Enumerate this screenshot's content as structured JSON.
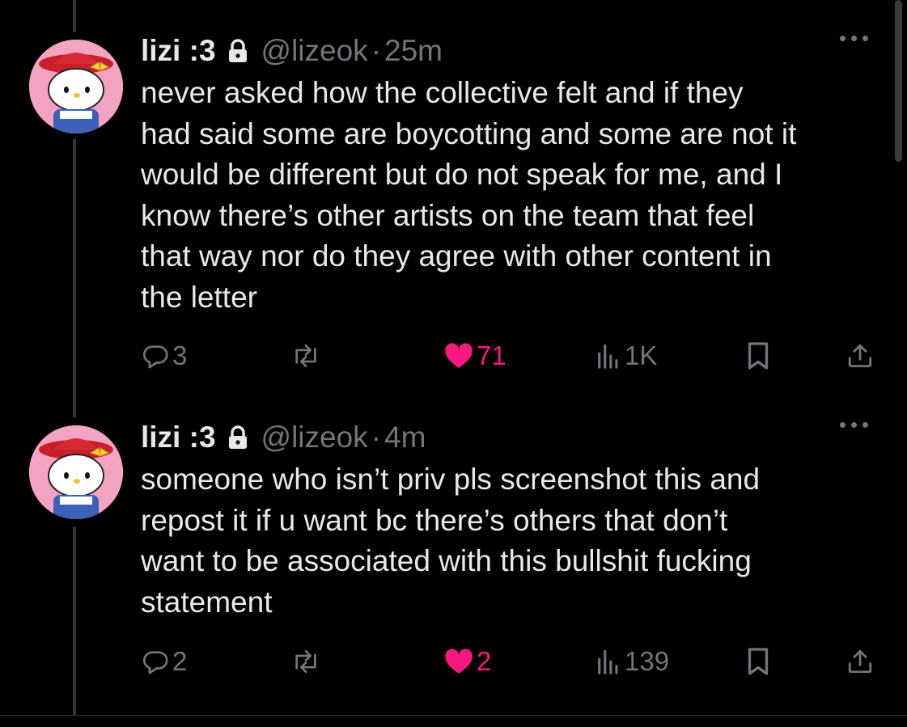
{
  "tweets": [
    {
      "display_name": "lizi :3",
      "handle": "@lizeok",
      "separator": "·",
      "time": "25m",
      "text": "never asked how the collective felt and if they\nhad said some are boycotting and some are not it\nwould be different but do not speak for me, and I\nknow there’s other artists on the team that feel\nthat way nor do they agree with other content in\nthe letter",
      "replies": "3",
      "likes": "71",
      "views": "1K",
      "liked": true
    },
    {
      "display_name": "lizi :3",
      "handle": "@lizeok",
      "separator": "·",
      "time": "4m",
      "text": "someone who isn’t priv pls screenshot this and\nrepost it if u want bc there’s others that don’t\nwant to be associated with this bullshit fucking\nstatement",
      "replies": "2",
      "likes": "2",
      "views": "139",
      "liked": true
    }
  ],
  "icons": {
    "protected": "lock-icon",
    "reply": "reply-icon",
    "repost": "repost-icon",
    "like": "heart-icon",
    "views": "views-icon",
    "bookmark": "bookmark-icon",
    "share": "share-icon",
    "more": "more-icon"
  },
  "colors": {
    "background": "#000000",
    "text": "#e7e9ea",
    "muted": "#71767b",
    "like": "#f91880",
    "avatar_bg": "#f4a3c3"
  }
}
